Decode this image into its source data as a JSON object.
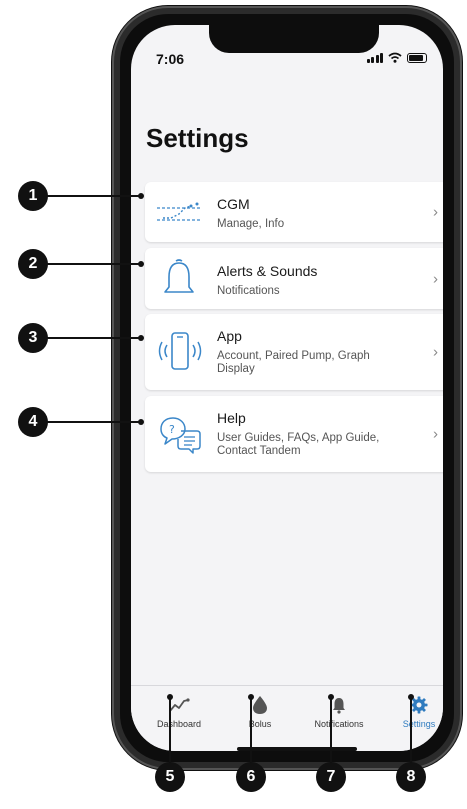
{
  "status": {
    "time": "7:06"
  },
  "page": {
    "title": "Settings"
  },
  "settings_items": [
    {
      "title": "CGM",
      "subtitle": "Manage, Info",
      "icon": "cgm-graph-icon"
    },
    {
      "title": "Alerts & Sounds",
      "subtitle": "Notifications",
      "icon": "bell-icon"
    },
    {
      "title": "App",
      "subtitle": "Account, Paired Pump, Graph Display",
      "icon": "phone-vibrate-icon"
    },
    {
      "title": "Help",
      "subtitle": "User Guides, FAQs, App Guide, Contact Tandem",
      "icon": "help-chat-icon"
    }
  ],
  "tabs": [
    {
      "label": "Dashboard",
      "icon": "trend-graph-icon",
      "active": false
    },
    {
      "label": "Bolus",
      "icon": "drop-icon",
      "active": false
    },
    {
      "label": "Notifications",
      "icon": "bell-icon",
      "active": false
    },
    {
      "label": "Settings",
      "icon": "gear-icon",
      "active": true
    }
  ],
  "callouts": [
    "1",
    "2",
    "3",
    "4",
    "5",
    "6",
    "7",
    "8"
  ],
  "colors": {
    "accent": "#2f7bbf",
    "icon_blue": "#3b87c9",
    "tab_icon": "#555555",
    "callout": "#111111"
  }
}
